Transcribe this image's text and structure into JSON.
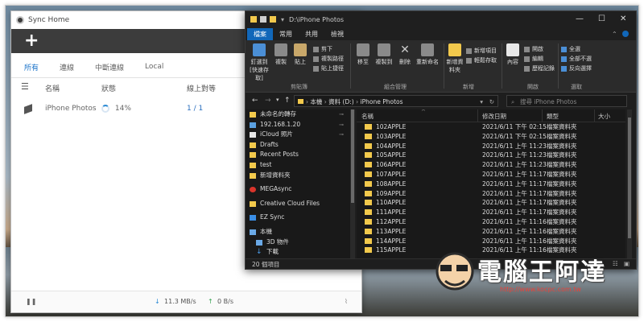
{
  "sync_window": {
    "title": "Sync Home",
    "tabs": [
      "所有",
      "連線",
      "中斷連線",
      "Local"
    ],
    "columns": [
      "名稱",
      "狀態",
      "線上對等"
    ],
    "rows": [
      {
        "name": "iPhone Photos",
        "status": "14%",
        "peers": "1 / 1"
      }
    ],
    "statusbar": {
      "download": "11.3 MB/s",
      "upload": "0 B/s"
    }
  },
  "explorer": {
    "title": "D:\\iPhone Photos",
    "ribbon_tabs": [
      "檔案",
      "常用",
      "共用",
      "檢視"
    ],
    "ribbon": {
      "clipboard": {
        "pin_label": "釘選到 [快速存取]",
        "copy_label": "複製",
        "paste_label": "貼上",
        "cut": "剪下",
        "copy_path": "複製路徑",
        "paste_shortcut": "貼上捷徑",
        "group": "剪貼簿"
      },
      "organize": {
        "move_to": "移至",
        "copy_to": "複製到",
        "delete": "刪除",
        "rename": "重新命名",
        "group": "組合管理"
      },
      "new": {
        "new_folder": "新增資料夾",
        "new_item": "新增項目",
        "easy_access": "輕鬆存取",
        "group": "新增"
      },
      "open": {
        "properties": "內容",
        "open": "開啟",
        "edit": "編輯",
        "history": "歷程記錄",
        "group": "開啟"
      },
      "select": {
        "select_all": "全選",
        "select_none": "全部不選",
        "invert": "反向選擇",
        "group": "選取"
      }
    },
    "address": {
      "path": [
        "本機",
        "資料 (D:)",
        "iPhone Photos"
      ],
      "search_placeholder": "搜尋 iPhone Photos"
    },
    "nav_items": [
      {
        "label": "未命名的轉存",
        "pinned": true
      },
      {
        "label": "192.168.1.20",
        "pinned": true
      },
      {
        "label": "iCloud 照片",
        "pinned": true
      },
      {
        "label": "Drafts"
      },
      {
        "label": "Recent Posts"
      },
      {
        "label": "test"
      },
      {
        "label": "新增資料夾"
      },
      {
        "label": "MEGAsync"
      },
      {
        "label": "Creative Cloud Files"
      },
      {
        "label": "EZ Sync"
      },
      {
        "label": "本機"
      },
      {
        "label": "3D 物件"
      },
      {
        "label": "下載"
      }
    ],
    "columns": [
      "名稱",
      "修改日期",
      "類型",
      "大小"
    ],
    "files": [
      {
        "name": "102APPLE",
        "date": "2021/6/11 下午 02:15",
        "type": "檔案資料夾"
      },
      {
        "name": "103APPLE",
        "date": "2021/6/11 下午 02:15",
        "type": "檔案資料夾"
      },
      {
        "name": "104APPLE",
        "date": "2021/6/11 上午 11:23",
        "type": "檔案資料夾"
      },
      {
        "name": "105APPLE",
        "date": "2021/6/11 上午 11:23",
        "type": "檔案資料夾"
      },
      {
        "name": "106APPLE",
        "date": "2021/6/11 上午 11:23",
        "type": "檔案資料夾"
      },
      {
        "name": "107APPLE",
        "date": "2021/6/11 上午 11:17",
        "type": "檔案資料夾"
      },
      {
        "name": "108APPLE",
        "date": "2021/6/11 上午 11:17",
        "type": "檔案資料夾"
      },
      {
        "name": "109APPLE",
        "date": "2021/6/11 上午 11:17",
        "type": "檔案資料夾"
      },
      {
        "name": "110APPLE",
        "date": "2021/6/11 上午 11:17",
        "type": "檔案資料夾"
      },
      {
        "name": "111APPLE",
        "date": "2021/6/11 上午 11:17",
        "type": "檔案資料夾"
      },
      {
        "name": "112APPLE",
        "date": "2021/6/11 上午 11:16",
        "type": "檔案資料夾"
      },
      {
        "name": "113APPLE",
        "date": "2021/6/11 上午 11:16",
        "type": "檔案資料夾"
      },
      {
        "name": "114APPLE",
        "date": "2021/6/11 上午 11:16",
        "type": "檔案資料夾"
      },
      {
        "name": "115APPLE",
        "date": "2021/6/11 上午 11:16",
        "type": "檔案資料夾"
      }
    ],
    "status": "20 個項目",
    "accent": "#1167b9",
    "folder_color": "#f2c94c"
  },
  "watermark": {
    "text": "電腦王阿達",
    "url": "http://www.kocpc.com.tw"
  }
}
